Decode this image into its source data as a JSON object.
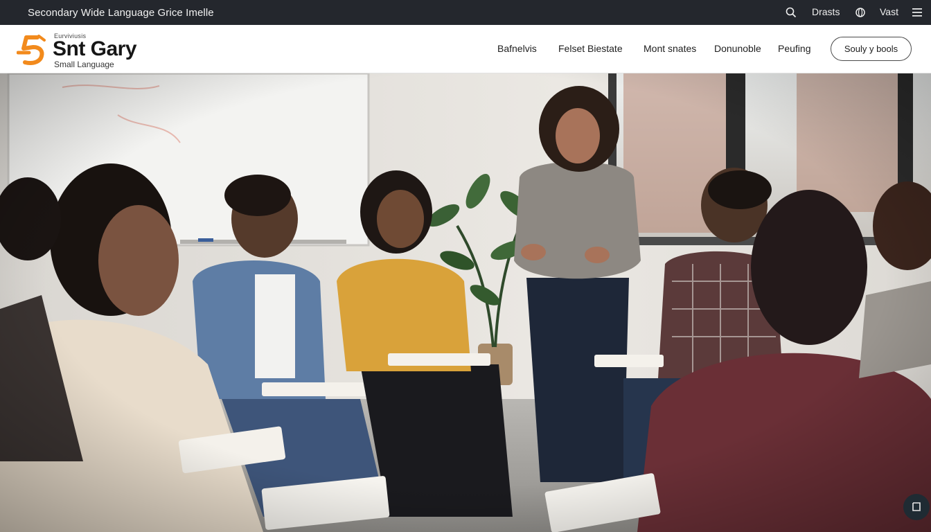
{
  "topbar": {
    "site_title": "Secondary Wide Language Grice Imelle",
    "link_1": "Drasts",
    "link_2": "Vast"
  },
  "logo": {
    "tagline_small": "Eurviviusis",
    "brand": "Snt Gary",
    "sub": "Small Language",
    "accent_color": "#f28a1c"
  },
  "nav": {
    "items": [
      "Bafnelvis",
      "Felset Biestate",
      "Mont snates",
      "Donunoble",
      "Peufing"
    ],
    "cta": "Souly y bools"
  },
  "hero": {
    "image_subject": "classroom-discussion-photo"
  },
  "icons": {
    "search": "search-icon",
    "globe": "globe-icon",
    "menu": "menu-icon",
    "corner": "crop-icon"
  }
}
